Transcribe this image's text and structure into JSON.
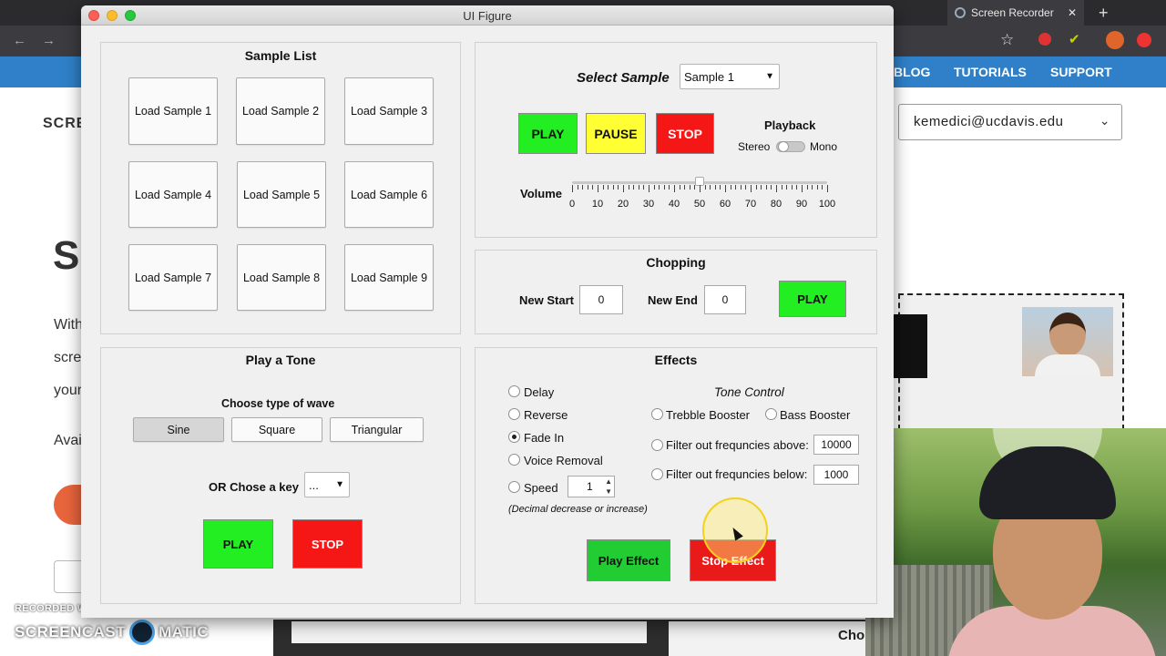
{
  "browser": {
    "active_tab_title": "Screen Recorder",
    "tab_close_glyph": "✕",
    "new_tab_glyph": "+",
    "nav_links": [
      "BLOG",
      "TUTORIALS",
      "SUPPORT"
    ],
    "account_email": "kemedici@ucdavis.edu",
    "bg_fragments": {
      "logo_fragment": "SCRE",
      "heading_fragment": "S",
      "para1": "With",
      "para2": "scre",
      "para3": "your",
      "para4": "Avai",
      "bottom_right": "Cho"
    }
  },
  "screencast": {
    "recorded_with": "RECORDED WITH",
    "brand_left": "SCREENCAST",
    "brand_right": "MATIC"
  },
  "figure": {
    "title": "UI Figure",
    "sample_list": {
      "title": "Sample List",
      "buttons": [
        "Load Sample 1",
        "Load Sample 2",
        "Load Sample 3",
        "Load Sample 4",
        "Load Sample 5",
        "Load Sample 6",
        "Load Sample 7",
        "Load Sample 8",
        "Load Sample 9"
      ]
    },
    "playback_panel": {
      "select_label": "Select Sample",
      "selected_sample": "Sample 1",
      "play": "PLAY",
      "pause": "PAUSE",
      "stop": "STOP",
      "playback_label": "Playback",
      "stereo": "Stereo",
      "mono": "Mono",
      "volume_label": "Volume",
      "volume_ticks": [
        "0",
        "10",
        "20",
        "30",
        "40",
        "50",
        "60",
        "70",
        "80",
        "90",
        "100"
      ],
      "volume_value": 50
    },
    "chopping": {
      "title": "Chopping",
      "new_start_label": "New Start",
      "new_start_value": "0",
      "new_end_label": "New End",
      "new_end_value": "0",
      "play": "PLAY"
    },
    "tone": {
      "title": "Play a Tone",
      "wave_label": "Choose type of wave",
      "waves": [
        "Sine",
        "Square",
        "Triangular"
      ],
      "selected_wave": "Sine",
      "key_label": "OR Chose a key",
      "key_value": "...",
      "play": "PLAY",
      "stop": "STOP"
    },
    "effects": {
      "title": "Effects",
      "options": [
        "Delay",
        "Reverse",
        "Fade In",
        "Voice Removal",
        "Speed"
      ],
      "selected_option": "Fade In",
      "speed_value": "1",
      "speed_hint": "(Decimal decrease or increase)",
      "tone_control_label": "Tone Control",
      "treble": "Trebble Booster",
      "bass": "Bass Booster",
      "filter_above_label": "Filter out frequncies above:",
      "filter_above_value": "10000",
      "filter_below_label": "Filter out frequncies below:",
      "filter_below_value": "1000",
      "play_effect": "Play Effect",
      "stop_effect": "Stop Effect"
    }
  },
  "colors": {
    "green": "#22ee22",
    "yellow": "#ffff33",
    "red": "#f51616",
    "dark_green": "#22cc33",
    "dark_red": "#e81a1a"
  }
}
